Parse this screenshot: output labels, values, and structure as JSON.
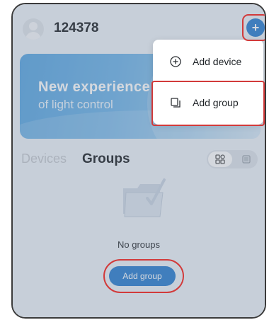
{
  "header": {
    "username": "124378",
    "add_icon": "plus-icon",
    "avatar_icon": "user-avatar-icon"
  },
  "banner": {
    "title": "New experience",
    "subtitle": "of light control"
  },
  "tabs": [
    {
      "label": "Devices",
      "active": false
    },
    {
      "label": "Groups",
      "active": true
    }
  ],
  "view_toggle": {
    "grid_icon": "grid-view-icon",
    "list_icon": "list-view-icon",
    "selected": "grid"
  },
  "empty_state": {
    "icon": "folder-icon",
    "message": "No groups",
    "button_label": "Add group"
  },
  "menu": {
    "items": [
      {
        "label": "Add device",
        "icon": "plus-circle-icon"
      },
      {
        "label": "Add group",
        "icon": "group-icon"
      }
    ]
  },
  "colors": {
    "accent": "#2c7fd0",
    "highlight": "#d23a3a",
    "overlay": "#707e91"
  }
}
